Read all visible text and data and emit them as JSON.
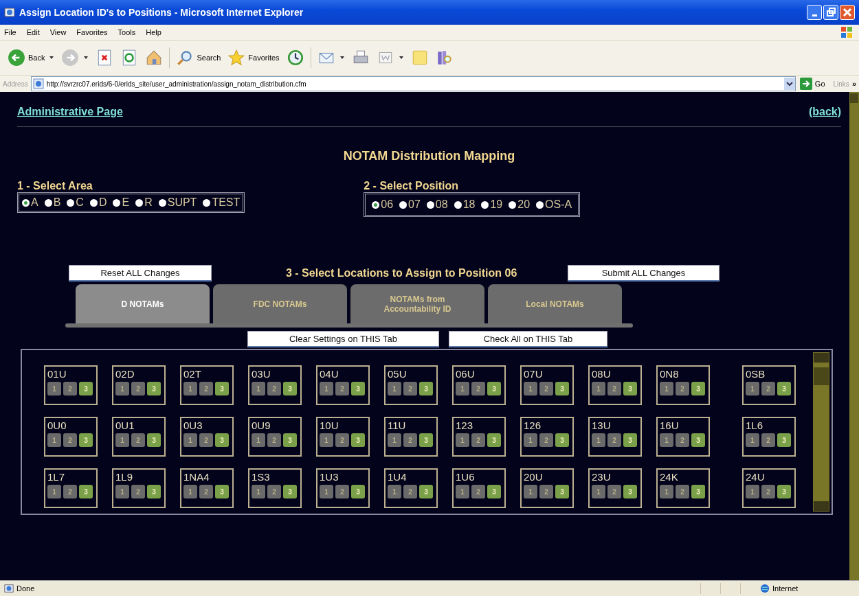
{
  "window": {
    "title": "Assign Location ID's to Positions - Microsoft Internet Explorer"
  },
  "menu": [
    "File",
    "Edit",
    "View",
    "Favorites",
    "Tools",
    "Help"
  ],
  "toolbar": [
    {
      "kind": "back",
      "label": "Back"
    },
    {
      "kind": "forward"
    },
    {
      "kind": "stop"
    },
    {
      "kind": "refresh"
    },
    {
      "kind": "home"
    },
    {
      "kind": "search",
      "label": "Search"
    },
    {
      "kind": "favorites",
      "label": "Favorites"
    },
    {
      "kind": "history"
    },
    {
      "kind": "mail"
    },
    {
      "kind": "print"
    },
    {
      "kind": "word"
    },
    {
      "kind": "note"
    },
    {
      "kind": "research"
    }
  ],
  "address": {
    "label": "Address",
    "url": "http://svrzrc07.erids/6-0/erids_site/user_administration/assign_notam_distribution.cfm",
    "go": "Go",
    "links": "Links",
    "more": "»"
  },
  "header": {
    "link": "Administrative Page",
    "back": "(back)"
  },
  "title": "NOTAM Distribution Mapping",
  "area": {
    "label": "1 - Select Area",
    "options": [
      {
        "label": "A",
        "selected": true
      },
      {
        "label": "B",
        "selected": false
      },
      {
        "label": "C",
        "selected": false
      },
      {
        "label": "D",
        "selected": false
      },
      {
        "label": "E",
        "selected": false
      },
      {
        "label": "R",
        "selected": false
      },
      {
        "label": "SUPT",
        "selected": false
      },
      {
        "label": "TEST",
        "selected": false
      }
    ]
  },
  "position": {
    "label": "2 - Select Position",
    "options": [
      {
        "label": "06",
        "selected": true
      },
      {
        "label": "07",
        "selected": false
      },
      {
        "label": "08",
        "selected": false
      },
      {
        "label": "18",
        "selected": false
      },
      {
        "label": "19",
        "selected": false
      },
      {
        "label": "20",
        "selected": false
      },
      {
        "label": "OS-A",
        "selected": false
      }
    ]
  },
  "reset_button": "Reset ALL Changes",
  "heading": "3 - Select Locations to Assign to Position 06",
  "submit_button": "Submit ALL Changes",
  "tabs": [
    {
      "label": "D NOTAMs",
      "selected": true
    },
    {
      "label": "FDC NOTAMs",
      "selected": false
    },
    {
      "label": "NOTAMs from Accountability ID",
      "selected": false
    },
    {
      "label": "Local NOTAMs",
      "selected": false
    }
  ],
  "clear_button": "Clear Settings on THIS Tab",
  "check_all_button": "Check All on THIS Tab",
  "locations": [
    {
      "id": "01U",
      "buttons": [
        {
          "label": "1",
          "selected": false
        },
        {
          "label": "2",
          "selected": false
        },
        {
          "label": "3",
          "selected": true
        }
      ]
    },
    {
      "id": "02D",
      "buttons": [
        {
          "label": "1",
          "selected": false
        },
        {
          "label": "2",
          "selected": false
        },
        {
          "label": "3",
          "selected": true
        }
      ]
    },
    {
      "id": "02T",
      "buttons": [
        {
          "label": "1",
          "selected": false
        },
        {
          "label": "2",
          "selected": false
        },
        {
          "label": "3",
          "selected": true
        }
      ]
    },
    {
      "id": "03U",
      "buttons": [
        {
          "label": "1",
          "selected": false
        },
        {
          "label": "2",
          "selected": false
        },
        {
          "label": "3",
          "selected": true
        }
      ]
    },
    {
      "id": "04U",
      "buttons": [
        {
          "label": "1",
          "selected": false
        },
        {
          "label": "2",
          "selected": false
        },
        {
          "label": "3",
          "selected": true
        }
      ]
    },
    {
      "id": "05U",
      "buttons": [
        {
          "label": "1",
          "selected": false
        },
        {
          "label": "2",
          "selected": false
        },
        {
          "label": "3",
          "selected": true
        }
      ]
    },
    {
      "id": "06U",
      "buttons": [
        {
          "label": "1",
          "selected": false
        },
        {
          "label": "2",
          "selected": false
        },
        {
          "label": "3",
          "selected": true
        }
      ]
    },
    {
      "id": "07U",
      "buttons": [
        {
          "label": "1",
          "selected": false
        },
        {
          "label": "2",
          "selected": false
        },
        {
          "label": "3",
          "selected": true
        }
      ]
    },
    {
      "id": "08U",
      "buttons": [
        {
          "label": "1",
          "selected": false
        },
        {
          "label": "2",
          "selected": false
        },
        {
          "label": "3",
          "selected": true
        }
      ]
    },
    {
      "id": "0N8",
      "buttons": [
        {
          "label": "1",
          "selected": false
        },
        {
          "label": "2",
          "selected": false
        },
        {
          "label": "3",
          "selected": true
        }
      ]
    },
    {
      "id": "0SB",
      "buttons": [
        {
          "label": "1",
          "selected": false
        },
        {
          "label": "2",
          "selected": false
        },
        {
          "label": "3",
          "selected": true
        }
      ]
    },
    {
      "id": "0U0",
      "buttons": [
        {
          "label": "1",
          "selected": false
        },
        {
          "label": "2",
          "selected": false
        },
        {
          "label": "3",
          "selected": true
        }
      ]
    },
    {
      "id": "0U1",
      "buttons": [
        {
          "label": "1",
          "selected": false
        },
        {
          "label": "2",
          "selected": false
        },
        {
          "label": "3",
          "selected": true
        }
      ]
    },
    {
      "id": "0U3",
      "buttons": [
        {
          "label": "1",
          "selected": false
        },
        {
          "label": "2",
          "selected": false
        },
        {
          "label": "3",
          "selected": true
        }
      ]
    },
    {
      "id": "0U9",
      "buttons": [
        {
          "label": "1",
          "selected": false
        },
        {
          "label": "2",
          "selected": false
        },
        {
          "label": "3",
          "selected": true
        }
      ]
    },
    {
      "id": "10U",
      "buttons": [
        {
          "label": "1",
          "selected": false
        },
        {
          "label": "2",
          "selected": false
        },
        {
          "label": "3",
          "selected": true
        }
      ]
    },
    {
      "id": "11U",
      "buttons": [
        {
          "label": "1",
          "selected": false
        },
        {
          "label": "2",
          "selected": false
        },
        {
          "label": "3",
          "selected": true
        }
      ]
    },
    {
      "id": "123",
      "buttons": [
        {
          "label": "1",
          "selected": false
        },
        {
          "label": "2",
          "selected": false
        },
        {
          "label": "3",
          "selected": true
        }
      ]
    },
    {
      "id": "126",
      "buttons": [
        {
          "label": "1",
          "selected": false
        },
        {
          "label": "2",
          "selected": false
        },
        {
          "label": "3",
          "selected": true
        }
      ]
    },
    {
      "id": "13U",
      "buttons": [
        {
          "label": "1",
          "selected": false
        },
        {
          "label": "2",
          "selected": false
        },
        {
          "label": "3",
          "selected": true
        }
      ]
    },
    {
      "id": "16U",
      "buttons": [
        {
          "label": "1",
          "selected": false
        },
        {
          "label": "2",
          "selected": false
        },
        {
          "label": "3",
          "selected": true
        }
      ]
    },
    {
      "id": "1L6",
      "buttons": [
        {
          "label": "1",
          "selected": false
        },
        {
          "label": "2",
          "selected": false
        },
        {
          "label": "3",
          "selected": true
        }
      ]
    },
    {
      "id": "1L7",
      "buttons": [
        {
          "label": "1",
          "selected": false
        },
        {
          "label": "2",
          "selected": false
        },
        {
          "label": "3",
          "selected": true
        }
      ]
    },
    {
      "id": "1L9",
      "buttons": [
        {
          "label": "1",
          "selected": false
        },
        {
          "label": "2",
          "selected": false
        },
        {
          "label": "3",
          "selected": true
        }
      ]
    },
    {
      "id": "1NA4",
      "buttons": [
        {
          "label": "1",
          "selected": false
        },
        {
          "label": "2",
          "selected": false
        },
        {
          "label": "3",
          "selected": true
        }
      ]
    },
    {
      "id": "1S3",
      "buttons": [
        {
          "label": "1",
          "selected": false
        },
        {
          "label": "2",
          "selected": false
        },
        {
          "label": "3",
          "selected": true
        }
      ]
    },
    {
      "id": "1U3",
      "buttons": [
        {
          "label": "1",
          "selected": false
        },
        {
          "label": "2",
          "selected": false
        },
        {
          "label": "3",
          "selected": true
        }
      ]
    },
    {
      "id": "1U4",
      "buttons": [
        {
          "label": "1",
          "selected": false
        },
        {
          "label": "2",
          "selected": false
        },
        {
          "label": "3",
          "selected": true
        }
      ]
    },
    {
      "id": "1U6",
      "buttons": [
        {
          "label": "1",
          "selected": false
        },
        {
          "label": "2",
          "selected": false
        },
        {
          "label": "3",
          "selected": true
        }
      ]
    },
    {
      "id": "20U",
      "buttons": [
        {
          "label": "1",
          "selected": false
        },
        {
          "label": "2",
          "selected": false
        },
        {
          "label": "3",
          "selected": true
        }
      ]
    },
    {
      "id": "23U",
      "buttons": [
        {
          "label": "1",
          "selected": false
        },
        {
          "label": "2",
          "selected": false
        },
        {
          "label": "3",
          "selected": true
        }
      ]
    },
    {
      "id": "24K",
      "buttons": [
        {
          "label": "1",
          "selected": false
        },
        {
          "label": "2",
          "selected": false
        },
        {
          "label": "3",
          "selected": true
        }
      ]
    },
    {
      "id": "24U",
      "buttons": [
        {
          "label": "1",
          "selected": false
        },
        {
          "label": "2",
          "selected": false
        },
        {
          "label": "3",
          "selected": true
        }
      ]
    }
  ],
  "status_bar": {
    "text": "Done",
    "zone": "Internet"
  }
}
